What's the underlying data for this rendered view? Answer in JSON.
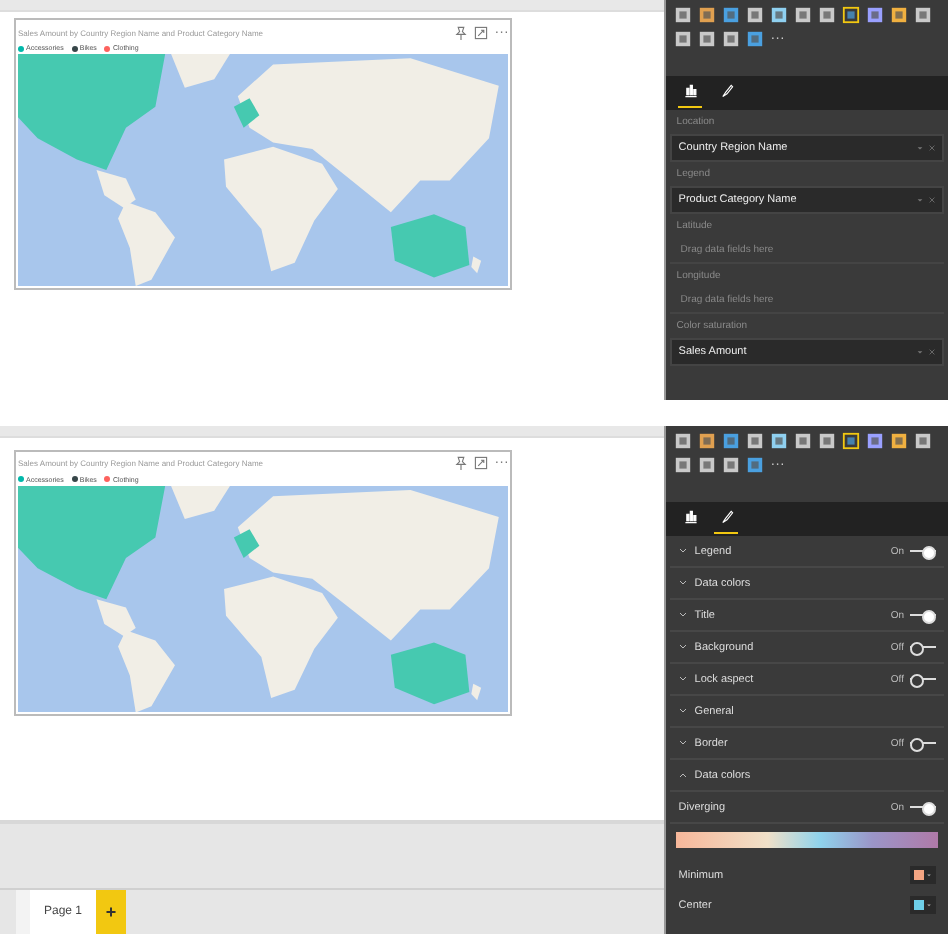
{
  "views": [
    {
      "visual": {
        "title": "Sales Amount by Country Region Name and Product Category Name",
        "legend": [
          {
            "label": "Accessories",
            "color": "#01b8aa"
          },
          {
            "label": "Bikes",
            "color": "#374649"
          },
          {
            "label": "Clothing",
            "color": "#fd625e"
          }
        ],
        "menu": "···"
      },
      "panel": {
        "viz_icons": [
          {
            "selected": false
          },
          {
            "selected": false
          },
          {
            "selected": false
          },
          {
            "selected": false
          },
          {
            "selected": false
          },
          {
            "selected": false
          },
          {
            "selected": false
          },
          {
            "selected": true
          },
          {
            "selected": false
          },
          {
            "selected": false
          },
          {
            "selected": false
          },
          {
            "selected": false
          },
          {
            "selected": false
          },
          {
            "selected": false
          },
          {
            "selected": false
          }
        ],
        "more": "···",
        "pane_tabs": [
          {
            "kind": "fields",
            "selected": true
          },
          {
            "kind": "format",
            "selected": false
          }
        ],
        "rows": [
          {
            "kind": "label",
            "text": "Location"
          },
          {
            "kind": "field",
            "text": "Country Region Name"
          },
          {
            "kind": "label",
            "text": "Legend"
          },
          {
            "kind": "field",
            "text": "Product Category Name"
          },
          {
            "kind": "label",
            "text": "Latitude"
          },
          {
            "kind": "placeholder",
            "text": "Drag data fields here"
          },
          {
            "kind": "label",
            "text": "Longitude"
          },
          {
            "kind": "placeholder",
            "text": "Drag data fields here"
          },
          {
            "kind": "label",
            "text": "Color saturation"
          },
          {
            "kind": "field",
            "text": "Sales Amount"
          }
        ]
      }
    },
    {
      "visual": {
        "title": "Sales Amount by Country Region Name and Product Category Name",
        "legend": [
          {
            "label": "Accessories",
            "color": "#01b8aa"
          },
          {
            "label": "Bikes",
            "color": "#374649"
          },
          {
            "label": "Clothing",
            "color": "#fd625e"
          }
        ],
        "menu": "···"
      },
      "panel": {
        "viz_icons": [
          {
            "selected": false
          },
          {
            "selected": false
          },
          {
            "selected": false
          },
          {
            "selected": false
          },
          {
            "selected": false
          },
          {
            "selected": false
          },
          {
            "selected": false
          },
          {
            "selected": true
          },
          {
            "selected": false
          },
          {
            "selected": false
          },
          {
            "selected": false
          },
          {
            "selected": false
          },
          {
            "selected": false
          },
          {
            "selected": false
          },
          {
            "selected": false
          }
        ],
        "more": "···",
        "pane_tabs": [
          {
            "kind": "fields",
            "selected": false
          },
          {
            "kind": "format",
            "selected": true
          }
        ],
        "rows": [
          {
            "kind": "section",
            "text": "Legend",
            "expanded": false,
            "state": "On",
            "on": true
          },
          {
            "kind": "section",
            "text": "Data colors",
            "expanded": false
          },
          {
            "kind": "section",
            "text": "Title",
            "expanded": false,
            "state": "On",
            "on": true
          },
          {
            "kind": "section",
            "text": "Background",
            "expanded": false,
            "state": "Off",
            "on": false
          },
          {
            "kind": "section",
            "text": "Lock aspect",
            "expanded": false,
            "state": "Off",
            "on": false
          },
          {
            "kind": "section",
            "text": "General",
            "expanded": false
          },
          {
            "kind": "section",
            "text": "Border",
            "expanded": false,
            "state": "Off",
            "on": false
          },
          {
            "kind": "section",
            "text": "Data colors",
            "expanded": true
          },
          {
            "kind": "toggle",
            "text": "Diverging",
            "state": "On",
            "on": true
          },
          {
            "kind": "gradient"
          },
          {
            "kind": "color",
            "text": "Minimum",
            "color": "#f4a582"
          },
          {
            "kind": "color",
            "text": "Center",
            "color": "#6ecfe8"
          }
        ]
      },
      "page_tabs": [
        {
          "label": "Page 1",
          "selected": true
        }
      ],
      "add": "+"
    }
  ]
}
